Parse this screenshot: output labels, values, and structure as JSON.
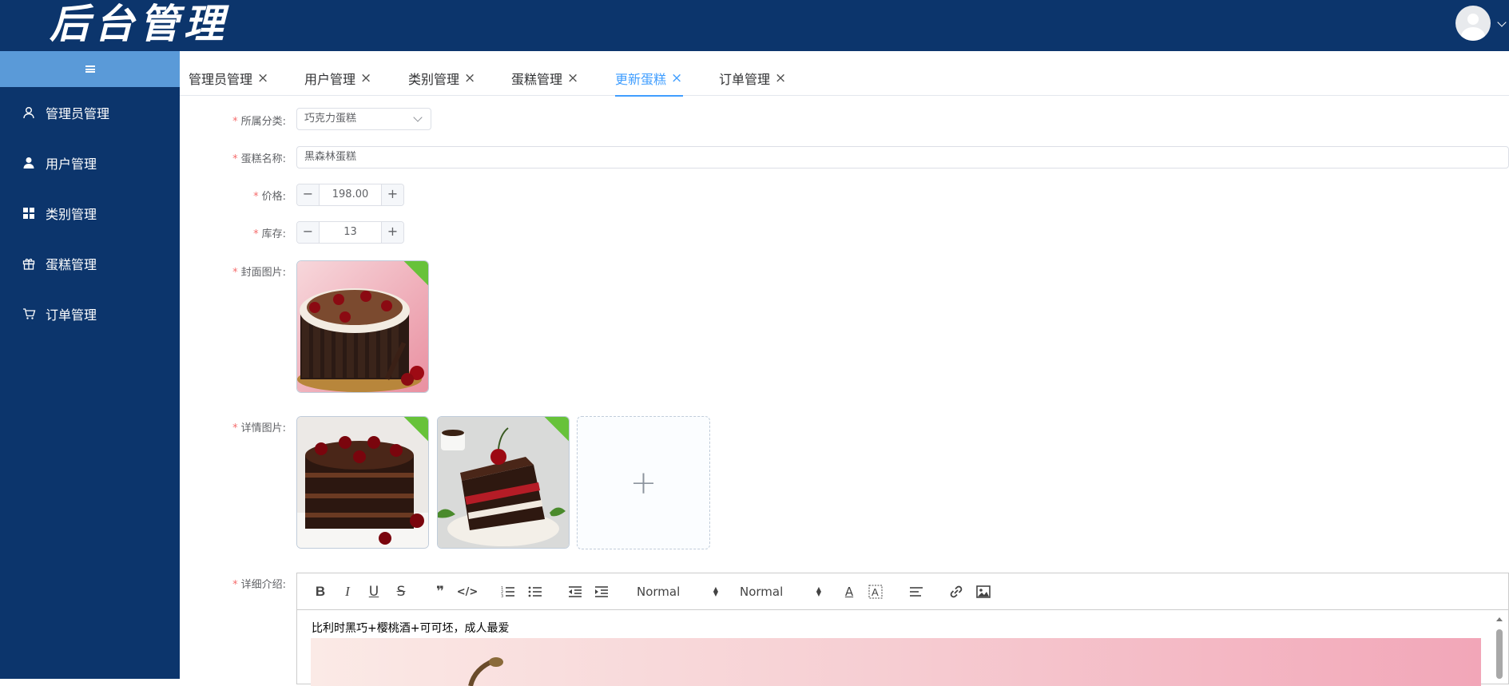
{
  "app": {
    "title": "后台管理"
  },
  "sidebar": {
    "items": [
      {
        "label": "管理员管理",
        "icon": "user-outline-icon"
      },
      {
        "label": "用户管理",
        "icon": "user-solid-icon"
      },
      {
        "label": "类别管理",
        "icon": "grid-icon"
      },
      {
        "label": "蛋糕管理",
        "icon": "gift-icon"
      },
      {
        "label": "订单管理",
        "icon": "cart-icon"
      }
    ]
  },
  "tabs": [
    {
      "label": "管理员管理"
    },
    {
      "label": "用户管理"
    },
    {
      "label": "类别管理"
    },
    {
      "label": "蛋糕管理"
    },
    {
      "label": "更新蛋糕",
      "active": true
    },
    {
      "label": "订单管理"
    }
  ],
  "form": {
    "category": {
      "label": "所属分类:",
      "value": "巧克力蛋糕"
    },
    "name": {
      "label": "蛋糕名称:",
      "value": "黑森林蛋糕"
    },
    "price": {
      "label": "价格:",
      "value": "198.00"
    },
    "stock": {
      "label": "库存:",
      "value": "13"
    },
    "cover": {
      "label": "封面图片:"
    },
    "details": {
      "label": "详情图片:"
    },
    "intro": {
      "label": "详细介绍:"
    }
  },
  "editor": {
    "header_picker": "Normal",
    "size_picker": "Normal",
    "content": "比利时黑巧+樱桃酒+可可坯，成人最爱"
  },
  "colors": {
    "header_bg": "#0c356c",
    "sidebar_bg": "#0c356c",
    "collapse_bg": "#5a9ad8",
    "accent": "#409eff",
    "success": "#67c23a",
    "required": "#f56c6c"
  }
}
